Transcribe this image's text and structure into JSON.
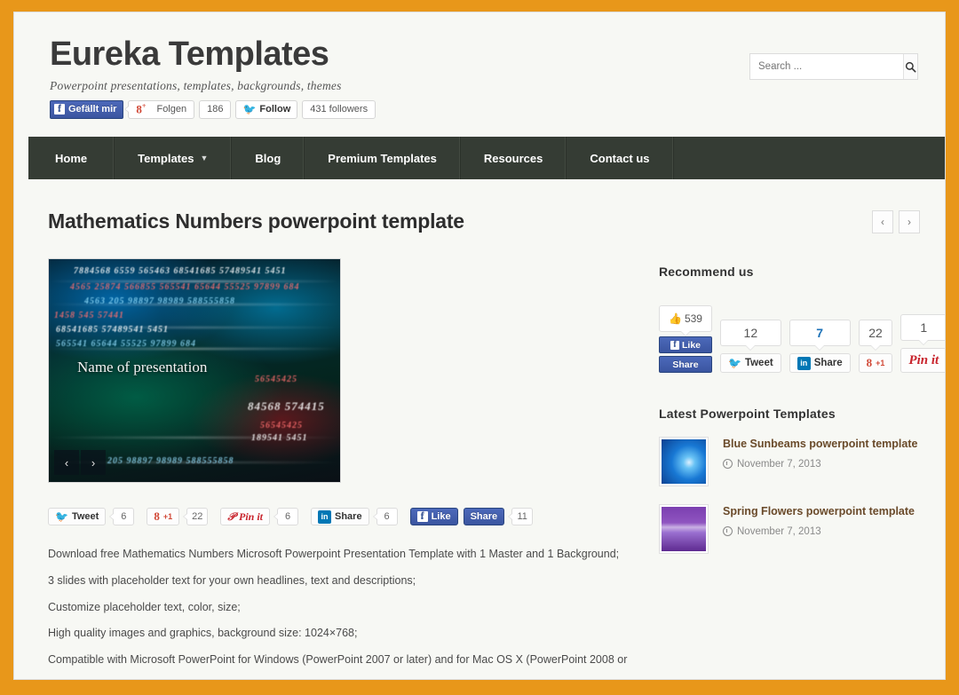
{
  "theme": {
    "frame_color": "#e8971a",
    "nav_bg": "#353c34",
    "page_bg": "#f7f8f4",
    "link_color": "#6a4a2a"
  },
  "header": {
    "site_title": "Eureka Templates",
    "tagline": "Powerpoint presentations, templates, backgrounds, themes",
    "social": {
      "facebook_like_label": "Gefällt mir",
      "gplus_label": "Folgen",
      "gplus_count": "186",
      "twitter_label": "Follow",
      "twitter_followers": "431 followers"
    },
    "search": {
      "placeholder": "Search ...",
      "value": "",
      "button_icon": "search-icon"
    }
  },
  "nav": {
    "items": [
      {
        "label": "Home",
        "has_dropdown": false
      },
      {
        "label": "Templates",
        "has_dropdown": true
      },
      {
        "label": "Blog",
        "has_dropdown": false
      },
      {
        "label": "Premium Templates",
        "has_dropdown": false
      },
      {
        "label": "Resources",
        "has_dropdown": false
      },
      {
        "label": "Contact us",
        "has_dropdown": false
      }
    ],
    "dropdown_icon": "chevron-down-icon"
  },
  "post": {
    "title": "Mathematics Numbers powerpoint template",
    "prev_icon": "chevron-left-icon",
    "next_icon": "chevron-right-icon",
    "featured_image": {
      "caption": "Name of presentation",
      "prev_icon": "chevron-left-icon",
      "next_icon": "chevron-right-icon",
      "number_strings": [
        "7884568  6559   565463        68541685          57489541     5451",
        "4565     25874   566855   565541  65644 55525 97899      684",
        "4563    205  98897 98989        588555858",
        "1458 545                                    57441",
        "68541685       57489541     5451",
        "565541  65644 55525 97899      684",
        "205  98897 98989       588555858",
        "56545425",
        "84568   574415",
        "189541   5451"
      ]
    },
    "share_bar": [
      {
        "name": "tweet",
        "label": "Tweet",
        "count": "6"
      },
      {
        "name": "gplus",
        "label": "+1",
        "count": "22"
      },
      {
        "name": "pinit",
        "label": "Pin it",
        "count": "6"
      },
      {
        "name": "linkedin",
        "label": "Share",
        "count": "6"
      },
      {
        "name": "facebook-like",
        "label": "Like",
        "count": ""
      },
      {
        "name": "facebook-share",
        "label": "Share",
        "count": "11"
      }
    ],
    "description_lines": [
      "Download free Mathematics Numbers Microsoft Powerpoint Presentation Template with 1 Master and 1 Background;",
      "3 slides with placeholder text for your own headlines, text and descriptions;",
      "Customize placeholder text, color, size;",
      "High quality images and graphics, background size: 1024×768;",
      "Compatible with Microsoft PowerPoint for Windows (PowerPoint 2007 or later) and for Mac OS X (PowerPoint 2008 or"
    ]
  },
  "sidebar": {
    "recommend": {
      "heading": "Recommend us",
      "facebook_like_count": "539",
      "facebook_like_label": "Like",
      "facebook_share_label": "Share",
      "tweet_count": "12",
      "tweet_label": "Tweet",
      "linkedin_count": "7",
      "linkedin_label": "Share",
      "gplus_count": "22",
      "gplus_label": "+1",
      "pinit_count": "1",
      "pinit_label": "Pin it"
    },
    "latest": {
      "heading": "Latest Powerpoint Templates",
      "items": [
        {
          "title": "Blue Sunbeams powerpoint template",
          "date": "November 7, 2013",
          "thumb_style": "blue",
          "date_icon": "clock-icon"
        },
        {
          "title": "Spring Flowers powerpoint template",
          "date": "November 7, 2013",
          "thumb_style": "purple",
          "date_icon": "clock-icon"
        }
      ]
    }
  }
}
